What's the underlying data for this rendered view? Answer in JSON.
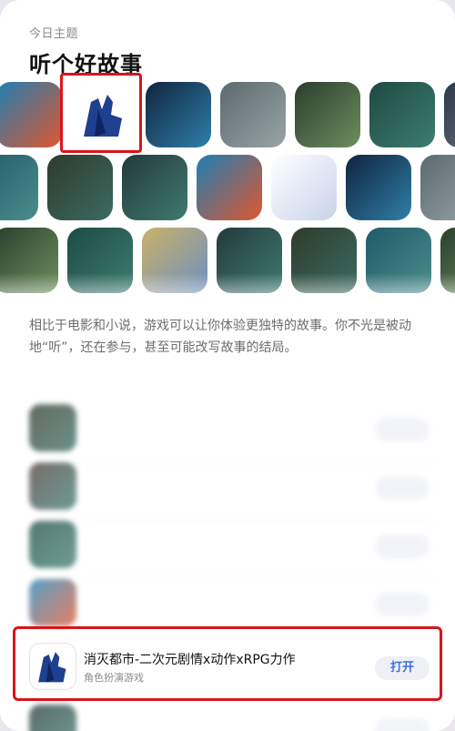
{
  "header": {
    "subtitle": "今日主题",
    "title": "听个好故事"
  },
  "description": "相比于电影和小说，游戏可以让你体验更独特的故事。你不光是被动地“听”，还在参与，甚至可能改写故事的结局。",
  "apps": [
    {
      "name": "",
      "category": "",
      "button": ""
    },
    {
      "name": "",
      "category": "",
      "button": ""
    },
    {
      "name": "",
      "category": "",
      "button": ""
    },
    {
      "name": "",
      "category": "",
      "button": ""
    },
    {
      "name": "消灭都市-二次元剧情x动作xRPG力作",
      "category": "角色扮演游戏",
      "button": "打开"
    },
    {
      "name": "",
      "category": "",
      "button": ""
    }
  ],
  "colors": {
    "highlight_border": "#d9141b",
    "button_text": "#3b6fe0",
    "button_bg": "#eef0f6"
  }
}
